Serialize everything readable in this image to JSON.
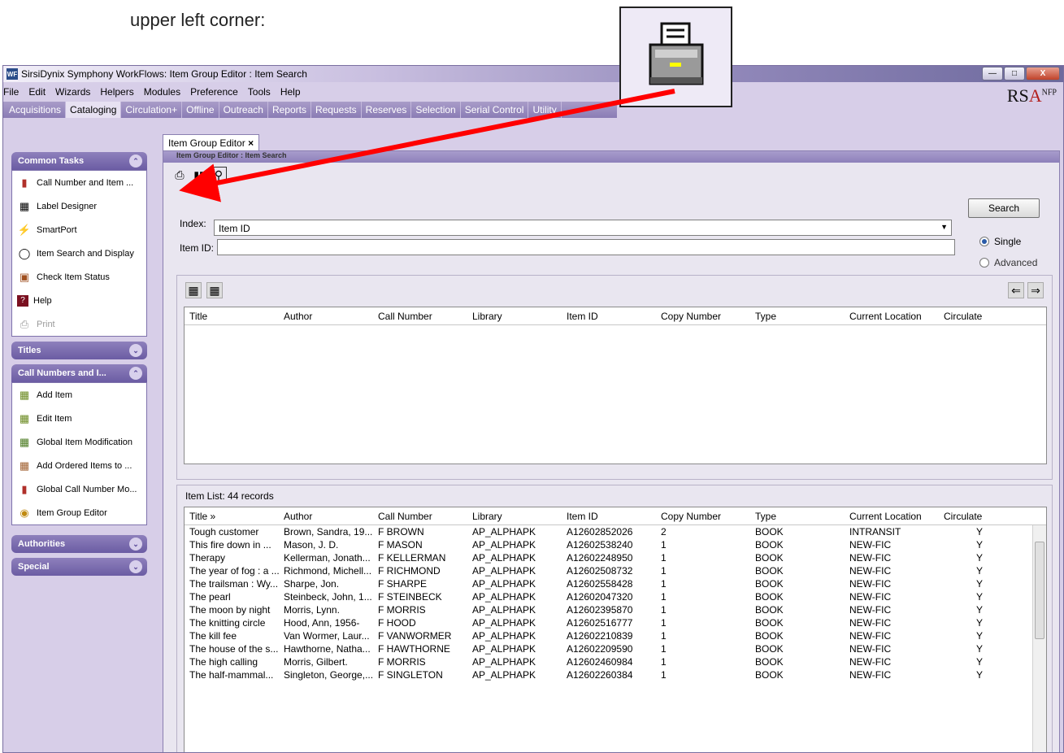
{
  "caption": "upper left corner:",
  "window": {
    "title": "SirsiDynix Symphony WorkFlows: Item Group Editor : Item Search",
    "title_icon": "WF",
    "logo": "RSA",
    "logo_sup": "NFP"
  },
  "menu": [
    "File",
    "Edit",
    "Wizards",
    "Helpers",
    "Modules",
    "Preference",
    "Tools",
    "Help"
  ],
  "modules": [
    "Acquisitions",
    "Cataloging",
    "Circulation+",
    "Offline",
    "Outreach",
    "Reports",
    "Requests",
    "Reserves",
    "Selection",
    "Serial Control",
    "Utility"
  ],
  "sidebar": {
    "common_tasks": {
      "title": "Common Tasks",
      "items": [
        {
          "label": "Call Number and Item ...",
          "icon": "books-icon"
        },
        {
          "label": "Label Designer",
          "icon": "label-icon"
        },
        {
          "label": "SmartPort",
          "icon": "lightning-icon"
        },
        {
          "label": "Item Search and Display",
          "icon": "binoculars-icon"
        },
        {
          "label": "Check Item Status",
          "icon": "item-status-icon"
        },
        {
          "label": "Help",
          "icon": "help-icon"
        },
        {
          "label": "Print",
          "icon": "printer-icon"
        }
      ]
    },
    "titles": {
      "title": "Titles"
    },
    "call_numbers": {
      "title": "Call Numbers and I...",
      "items": [
        {
          "label": "Add Item",
          "icon": "add-item-icon"
        },
        {
          "label": "Edit Item",
          "icon": "edit-item-icon"
        },
        {
          "label": "Global Item Modification",
          "icon": "global-modify-icon"
        },
        {
          "label": "Add Ordered Items to ...",
          "icon": "ordered-items-icon"
        },
        {
          "label": "Global Call Number Mo...",
          "icon": "global-call-number-icon"
        },
        {
          "label": "Item Group Editor",
          "icon": "group-editor-icon"
        }
      ]
    },
    "authorities": {
      "title": "Authorities"
    },
    "special": {
      "title": "Special"
    }
  },
  "tab": {
    "label": "Item Group Editor",
    "close": "×"
  },
  "subtitle": "Item Group Editor : Item Search",
  "search": {
    "index_label": "Index:",
    "index_value": "Item ID",
    "item_id_label": "Item ID:",
    "item_id_value": "",
    "search_button": "Search",
    "single": "Single",
    "advanced": "Advanced"
  },
  "columns": [
    "Title",
    "Author",
    "Call Number",
    "Library",
    "Item ID",
    "Copy Number",
    "Type",
    "Current Location",
    "Circulate"
  ],
  "item_list": {
    "label": "Item List: 44 records",
    "title_col": "Title »",
    "rows": [
      [
        "Tough customer",
        "Brown, Sandra, 19...",
        "F BROWN",
        "AP_ALPHAPK",
        "A12602852026",
        "2",
        "BOOK",
        "INTRANSIT",
        "Y"
      ],
      [
        "This fire down in ...",
        "Mason, J. D.",
        "F MASON",
        "AP_ALPHAPK",
        "A12602538240",
        "1",
        "BOOK",
        "NEW-FIC",
        "Y"
      ],
      [
        "Therapy",
        "Kellerman, Jonath...",
        "F KELLERMAN",
        "AP_ALPHAPK",
        "A12602248950",
        "1",
        "BOOK",
        "NEW-FIC",
        "Y"
      ],
      [
        "The year of fog : a ...",
        "Richmond, Michell...",
        "F RICHMOND",
        "AP_ALPHAPK",
        "A12602508732",
        "1",
        "BOOK",
        "NEW-FIC",
        "Y"
      ],
      [
        "The trailsman : Wy...",
        "Sharpe, Jon.",
        "F SHARPE",
        "AP_ALPHAPK",
        "A12602558428",
        "1",
        "BOOK",
        "NEW-FIC",
        "Y"
      ],
      [
        "The pearl",
        "Steinbeck, John, 1...",
        "F STEINBECK",
        "AP_ALPHAPK",
        "A12602047320",
        "1",
        "BOOK",
        "NEW-FIC",
        "Y"
      ],
      [
        "The moon by night",
        "Morris, Lynn.",
        "F MORRIS",
        "AP_ALPHAPK",
        "A12602395870",
        "1",
        "BOOK",
        "NEW-FIC",
        "Y"
      ],
      [
        "The knitting circle",
        "Hood, Ann, 1956-",
        "F HOOD",
        "AP_ALPHAPK",
        "A12602516777",
        "1",
        "BOOK",
        "NEW-FIC",
        "Y"
      ],
      [
        "The kill fee",
        "Van Wormer, Laur...",
        "F VANWORMER",
        "AP_ALPHAPK",
        "A12602210839",
        "1",
        "BOOK",
        "NEW-FIC",
        "Y"
      ],
      [
        "The house of the s...",
        "Hawthorne, Natha...",
        "F HAWTHORNE",
        "AP_ALPHAPK",
        "A12602209590",
        "1",
        "BOOK",
        "NEW-FIC",
        "Y"
      ],
      [
        "The high calling",
        "Morris, Gilbert.",
        "F MORRIS",
        "AP_ALPHAPK",
        "A12602460984",
        "1",
        "BOOK",
        "NEW-FIC",
        "Y"
      ],
      [
        "The half-mammal...",
        "Singleton, George,...",
        "F SINGLETON",
        "AP_ALPHAPK",
        "A12602260384",
        "1",
        "BOOK",
        "NEW-FIC",
        "Y"
      ]
    ]
  },
  "colors": {
    "accent": "#6b5ca3",
    "arrow": "#ff0000",
    "window_bg": "#d7cee8"
  }
}
